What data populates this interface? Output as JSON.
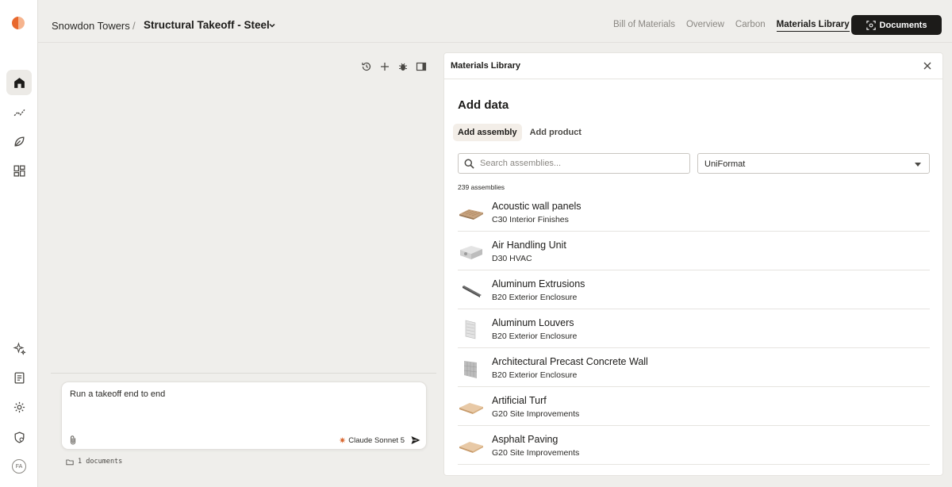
{
  "topbar": {
    "project": "Snowdon Towers",
    "separator": "/",
    "file": "Structural Takeoff - Steel",
    "nav": [
      "Bill of Materials",
      "Overview",
      "Carbon",
      "Materials Library"
    ],
    "active_nav": "Materials Library",
    "documents_button": "Documents",
    "more": "···"
  },
  "rail": {
    "avatar_initials": "FA"
  },
  "chat": {
    "input_text": "Run a takeoff end to end",
    "model_label": "Claude Sonnet 5",
    "documents_count": "1 documents"
  },
  "panel": {
    "title": "Materials Library",
    "heading": "Add data",
    "tabs": [
      "Add assembly",
      "Add product"
    ],
    "active_tab": "Add assembly",
    "search_placeholder": "Search assemblies...",
    "filter_value": "UniFormat",
    "count_label": "239 assemblies",
    "items": [
      {
        "name": "Acoustic wall panels",
        "category": "C30 Interior Finishes",
        "thumb": "panel"
      },
      {
        "name": "Air Handling Unit",
        "category": "D30 HVAC",
        "thumb": "ahu"
      },
      {
        "name": "Aluminum Extrusions",
        "category": "B20 Exterior Enclosure",
        "thumb": "extrusion"
      },
      {
        "name": "Aluminum Louvers",
        "category": "B20 Exterior Enclosure",
        "thumb": "louver"
      },
      {
        "name": "Architectural Precast Concrete Wall",
        "category": "B20 Exterior Enclosure",
        "thumb": "precast"
      },
      {
        "name": "Artificial Turf",
        "category": "G20 Site Improvements",
        "thumb": "slab"
      },
      {
        "name": "Asphalt Paving",
        "category": "G20 Site Improvements",
        "thumb": "slab"
      }
    ]
  },
  "colors": {
    "accent_dark": "#1c1b19",
    "brand_orange": "#e8682d",
    "tab_active_bg": "#f3eee8",
    "app_bg": "#efeeeb"
  }
}
